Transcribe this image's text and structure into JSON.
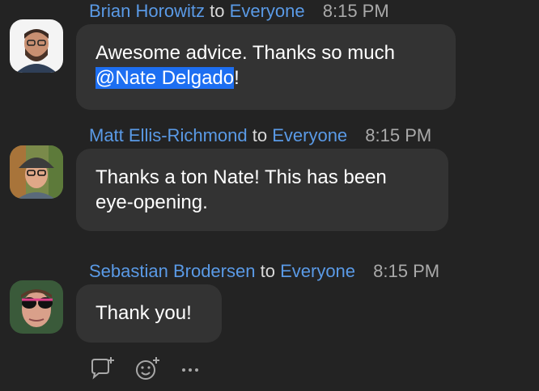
{
  "colors": {
    "background": "#232323",
    "bubble": "#333333",
    "name_link": "#5a9ae6",
    "mention_highlight": "#1d6ff2",
    "timestamp": "#a9a9a9"
  },
  "messages": [
    {
      "sender": "Brian Horowitz",
      "to_word": "to",
      "recipient": "Everyone",
      "time": "8:15 PM",
      "text_before": "Awesome advice. Thanks so much",
      "mention": "@Nate Delgado",
      "text_after": "!",
      "avatar_icon": "person-avatar-icon"
    },
    {
      "sender": "Matt Ellis-Richmond",
      "to_word": "to",
      "recipient": "Everyone",
      "time": "8:15 PM",
      "text_line1": "Thanks a ton Nate! This has been",
      "text_line2": "eye-opening.",
      "avatar_icon": "person-avatar-icon"
    },
    {
      "sender": "Sebastian Brodersen",
      "to_word": "to",
      "recipient": "Everyone",
      "time": "8:15 PM",
      "text": "Thank you!",
      "avatar_icon": "person-avatar-icon"
    }
  ],
  "actions": {
    "reply_icon": "reply-icon",
    "emoji_icon": "add-reaction-icon",
    "more_icon": "more-options-icon",
    "more_label": "···"
  }
}
